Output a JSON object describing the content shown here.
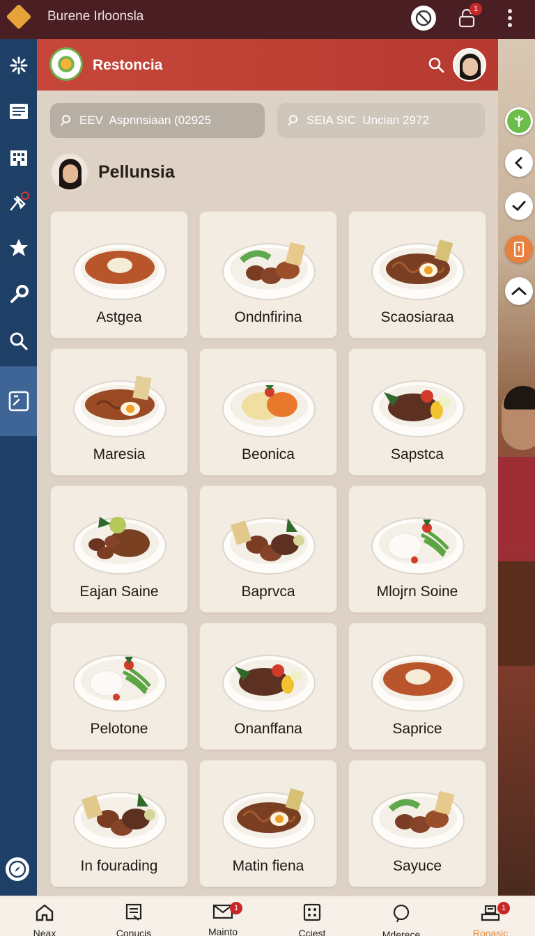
{
  "app": {
    "title": "Burene Irloonsla"
  },
  "topbar": {
    "lock_badge": "1"
  },
  "panel": {
    "title": "Restoncia",
    "search_1": {
      "placeholder": "EEV  Aspnnsiaan (02925"
    },
    "search_2": {
      "placeholder": "SEIA SIC  Uncian 2972"
    },
    "user_name": "Pellunsia"
  },
  "dishes": [
    {
      "name": "Astgea",
      "kind": "soup"
    },
    {
      "name": "Ondnfirina",
      "kind": "sausage"
    },
    {
      "name": "Scaosiaraa",
      "kind": "noodle"
    },
    {
      "name": "Maresia",
      "kind": "noodle-soup"
    },
    {
      "name": "Beonica",
      "kind": "pasta"
    },
    {
      "name": "Sapstca",
      "kind": "mince"
    },
    {
      "name": "Eajan Saine",
      "kind": "sausage-noodle"
    },
    {
      "name": "Baprvca",
      "kind": "meatball"
    },
    {
      "name": "Mlojrn Soine",
      "kind": "rice-beans"
    },
    {
      "name": "Pelotone",
      "kind": "rice-beans"
    },
    {
      "name": "Onanffana",
      "kind": "mince"
    },
    {
      "name": "Saprice",
      "kind": "soup"
    },
    {
      "name": "In fourading",
      "kind": "meatball"
    },
    {
      "name": "Matin fiena",
      "kind": "noodle"
    },
    {
      "name": "Sayuce",
      "kind": "sausage"
    }
  ],
  "bottom_nav": [
    {
      "label": "Neax",
      "icon": "home-icon",
      "badge": ""
    },
    {
      "label": "Conucis",
      "icon": "document-icon",
      "badge": ""
    },
    {
      "label": "Mainto",
      "icon": "mail-icon",
      "badge": "1"
    },
    {
      "label": "Cciest",
      "icon": "grid-icon",
      "badge": ""
    },
    {
      "label": "Mderece",
      "icon": "chat-icon",
      "badge": ""
    },
    {
      "label": "Ronasic",
      "icon": "tray-icon",
      "badge": "1",
      "active": true
    }
  ],
  "colors": {
    "accent": "#c6473a",
    "rail": "#1e3f66",
    "topbar": "#4a1f24",
    "active_nav": "#e8873a"
  }
}
